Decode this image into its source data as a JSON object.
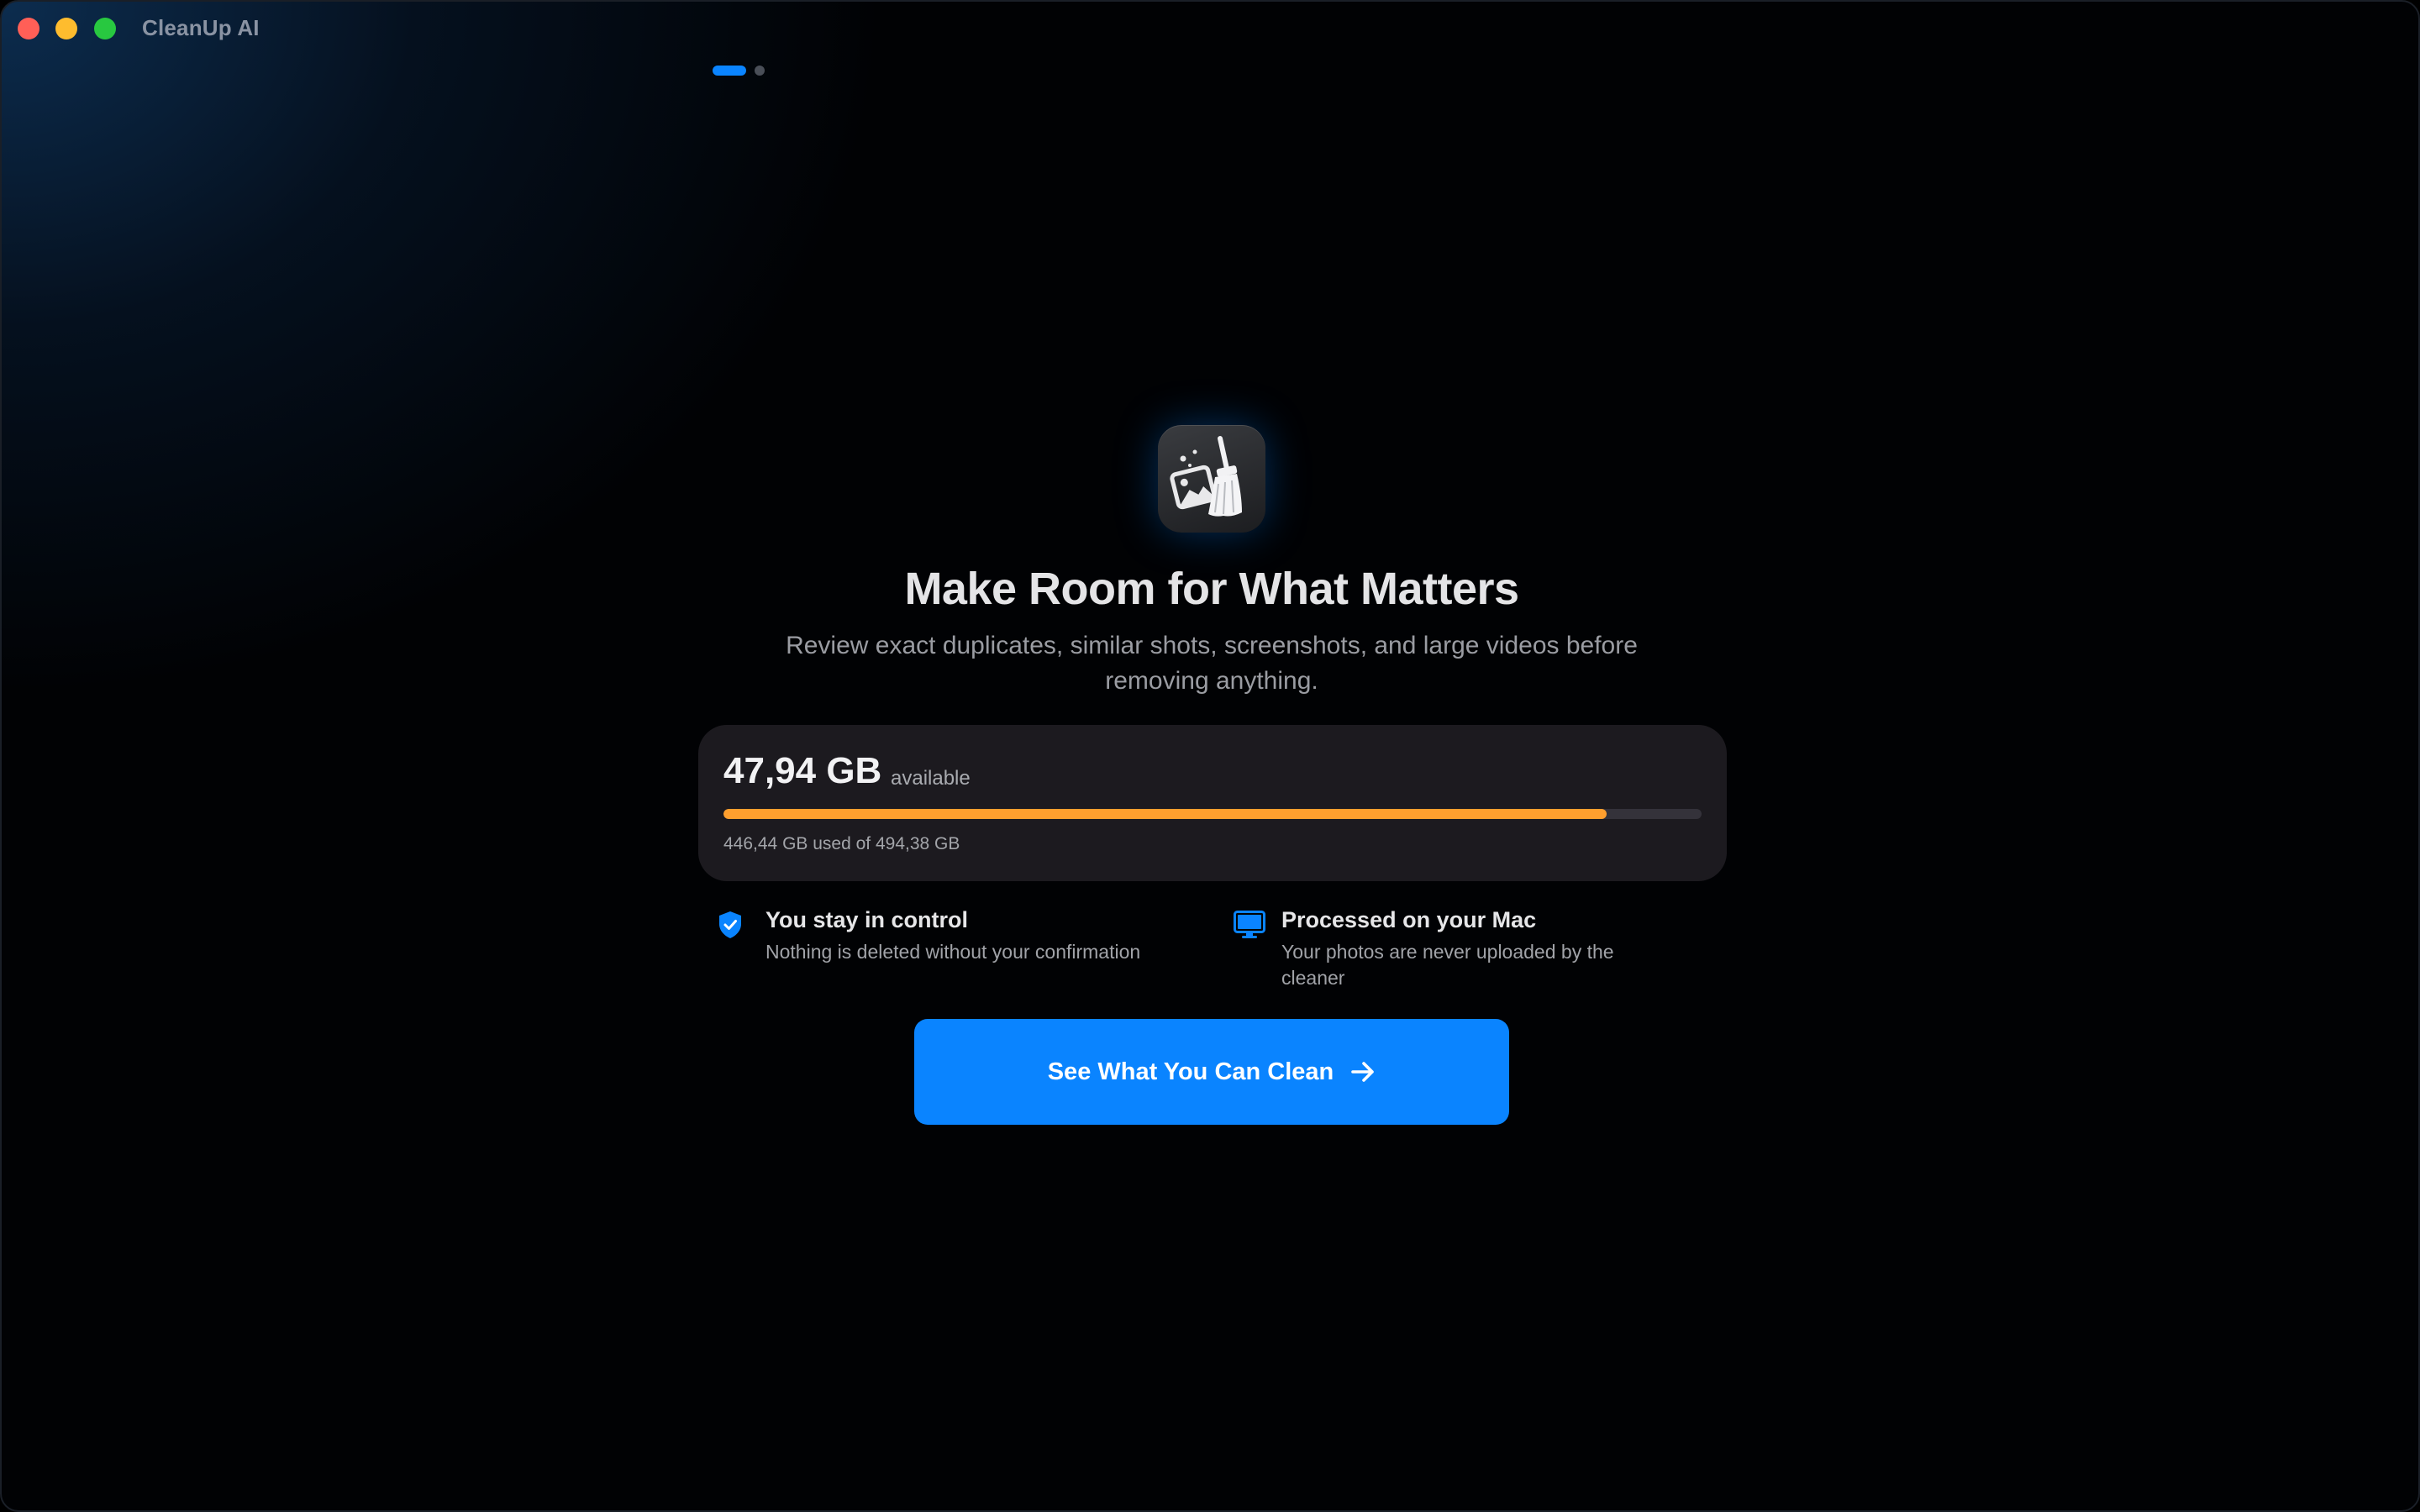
{
  "window": {
    "app_title": "CleanUp AI",
    "controls": {
      "close_color": "#ff5f57",
      "minimize_color": "#febc2e",
      "zoom_color": "#28c840"
    }
  },
  "pager": {
    "total_pages": 2,
    "current_page": 1
  },
  "onboarding": {
    "app_icon": "broom-with-photo-icon",
    "headline": "Make Room for What Matters",
    "subtext": "Review exact duplicates, similar shots, screenshots, and large videos before removing anything."
  },
  "storage": {
    "available_amount": "47,94 GB",
    "available_label": "available",
    "used_summary": "446,44 GB used of 494,38 GB",
    "used_fraction": 0.903,
    "bar_color": "#ff9f2e"
  },
  "features": [
    {
      "icon": "shield-check-icon",
      "title": "You stay in control",
      "description": "Nothing is deleted without your confirmation"
    },
    {
      "icon": "desktop-computer-icon",
      "title": "Processed on your Mac",
      "description": "Your photos are never uploaded by the cleaner"
    }
  ],
  "cta": {
    "label": "See What You Can Clean",
    "icon": "arrow-right-icon",
    "color": "#0a84ff"
  }
}
